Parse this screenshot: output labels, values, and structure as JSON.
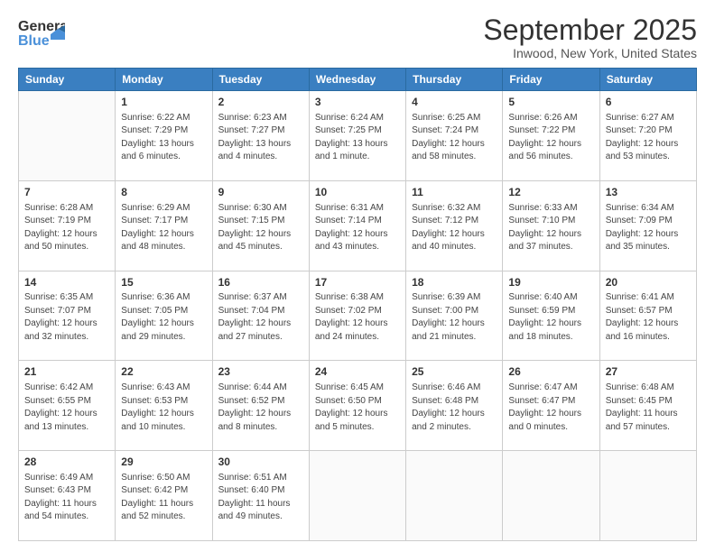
{
  "header": {
    "logo_line1": "General",
    "logo_line2": "Blue",
    "title": "September 2025",
    "subtitle": "Inwood, New York, United States"
  },
  "days_of_week": [
    "Sunday",
    "Monday",
    "Tuesday",
    "Wednesday",
    "Thursday",
    "Friday",
    "Saturday"
  ],
  "weeks": [
    [
      {
        "num": "",
        "sunrise": "",
        "sunset": "",
        "daylight": ""
      },
      {
        "num": "1",
        "sunrise": "Sunrise: 6:22 AM",
        "sunset": "Sunset: 7:29 PM",
        "daylight": "Daylight: 13 hours and 6 minutes."
      },
      {
        "num": "2",
        "sunrise": "Sunrise: 6:23 AM",
        "sunset": "Sunset: 7:27 PM",
        "daylight": "Daylight: 13 hours and 4 minutes."
      },
      {
        "num": "3",
        "sunrise": "Sunrise: 6:24 AM",
        "sunset": "Sunset: 7:25 PM",
        "daylight": "Daylight: 13 hours and 1 minute."
      },
      {
        "num": "4",
        "sunrise": "Sunrise: 6:25 AM",
        "sunset": "Sunset: 7:24 PM",
        "daylight": "Daylight: 12 hours and 58 minutes."
      },
      {
        "num": "5",
        "sunrise": "Sunrise: 6:26 AM",
        "sunset": "Sunset: 7:22 PM",
        "daylight": "Daylight: 12 hours and 56 minutes."
      },
      {
        "num": "6",
        "sunrise": "Sunrise: 6:27 AM",
        "sunset": "Sunset: 7:20 PM",
        "daylight": "Daylight: 12 hours and 53 minutes."
      }
    ],
    [
      {
        "num": "7",
        "sunrise": "Sunrise: 6:28 AM",
        "sunset": "Sunset: 7:19 PM",
        "daylight": "Daylight: 12 hours and 50 minutes."
      },
      {
        "num": "8",
        "sunrise": "Sunrise: 6:29 AM",
        "sunset": "Sunset: 7:17 PM",
        "daylight": "Daylight: 12 hours and 48 minutes."
      },
      {
        "num": "9",
        "sunrise": "Sunrise: 6:30 AM",
        "sunset": "Sunset: 7:15 PM",
        "daylight": "Daylight: 12 hours and 45 minutes."
      },
      {
        "num": "10",
        "sunrise": "Sunrise: 6:31 AM",
        "sunset": "Sunset: 7:14 PM",
        "daylight": "Daylight: 12 hours and 43 minutes."
      },
      {
        "num": "11",
        "sunrise": "Sunrise: 6:32 AM",
        "sunset": "Sunset: 7:12 PM",
        "daylight": "Daylight: 12 hours and 40 minutes."
      },
      {
        "num": "12",
        "sunrise": "Sunrise: 6:33 AM",
        "sunset": "Sunset: 7:10 PM",
        "daylight": "Daylight: 12 hours and 37 minutes."
      },
      {
        "num": "13",
        "sunrise": "Sunrise: 6:34 AM",
        "sunset": "Sunset: 7:09 PM",
        "daylight": "Daylight: 12 hours and 35 minutes."
      }
    ],
    [
      {
        "num": "14",
        "sunrise": "Sunrise: 6:35 AM",
        "sunset": "Sunset: 7:07 PM",
        "daylight": "Daylight: 12 hours and 32 minutes."
      },
      {
        "num": "15",
        "sunrise": "Sunrise: 6:36 AM",
        "sunset": "Sunset: 7:05 PM",
        "daylight": "Daylight: 12 hours and 29 minutes."
      },
      {
        "num": "16",
        "sunrise": "Sunrise: 6:37 AM",
        "sunset": "Sunset: 7:04 PM",
        "daylight": "Daylight: 12 hours and 27 minutes."
      },
      {
        "num": "17",
        "sunrise": "Sunrise: 6:38 AM",
        "sunset": "Sunset: 7:02 PM",
        "daylight": "Daylight: 12 hours and 24 minutes."
      },
      {
        "num": "18",
        "sunrise": "Sunrise: 6:39 AM",
        "sunset": "Sunset: 7:00 PM",
        "daylight": "Daylight: 12 hours and 21 minutes."
      },
      {
        "num": "19",
        "sunrise": "Sunrise: 6:40 AM",
        "sunset": "Sunset: 6:59 PM",
        "daylight": "Daylight: 12 hours and 18 minutes."
      },
      {
        "num": "20",
        "sunrise": "Sunrise: 6:41 AM",
        "sunset": "Sunset: 6:57 PM",
        "daylight": "Daylight: 12 hours and 16 minutes."
      }
    ],
    [
      {
        "num": "21",
        "sunrise": "Sunrise: 6:42 AM",
        "sunset": "Sunset: 6:55 PM",
        "daylight": "Daylight: 12 hours and 13 minutes."
      },
      {
        "num": "22",
        "sunrise": "Sunrise: 6:43 AM",
        "sunset": "Sunset: 6:53 PM",
        "daylight": "Daylight: 12 hours and 10 minutes."
      },
      {
        "num": "23",
        "sunrise": "Sunrise: 6:44 AM",
        "sunset": "Sunset: 6:52 PM",
        "daylight": "Daylight: 12 hours and 8 minutes."
      },
      {
        "num": "24",
        "sunrise": "Sunrise: 6:45 AM",
        "sunset": "Sunset: 6:50 PM",
        "daylight": "Daylight: 12 hours and 5 minutes."
      },
      {
        "num": "25",
        "sunrise": "Sunrise: 6:46 AM",
        "sunset": "Sunset: 6:48 PM",
        "daylight": "Daylight: 12 hours and 2 minutes."
      },
      {
        "num": "26",
        "sunrise": "Sunrise: 6:47 AM",
        "sunset": "Sunset: 6:47 PM",
        "daylight": "Daylight: 12 hours and 0 minutes."
      },
      {
        "num": "27",
        "sunrise": "Sunrise: 6:48 AM",
        "sunset": "Sunset: 6:45 PM",
        "daylight": "Daylight: 11 hours and 57 minutes."
      }
    ],
    [
      {
        "num": "28",
        "sunrise": "Sunrise: 6:49 AM",
        "sunset": "Sunset: 6:43 PM",
        "daylight": "Daylight: 11 hours and 54 minutes."
      },
      {
        "num": "29",
        "sunrise": "Sunrise: 6:50 AM",
        "sunset": "Sunset: 6:42 PM",
        "daylight": "Daylight: 11 hours and 52 minutes."
      },
      {
        "num": "30",
        "sunrise": "Sunrise: 6:51 AM",
        "sunset": "Sunset: 6:40 PM",
        "daylight": "Daylight: 11 hours and 49 minutes."
      },
      {
        "num": "",
        "sunrise": "",
        "sunset": "",
        "daylight": ""
      },
      {
        "num": "",
        "sunrise": "",
        "sunset": "",
        "daylight": ""
      },
      {
        "num": "",
        "sunrise": "",
        "sunset": "",
        "daylight": ""
      },
      {
        "num": "",
        "sunrise": "",
        "sunset": "",
        "daylight": ""
      }
    ]
  ]
}
